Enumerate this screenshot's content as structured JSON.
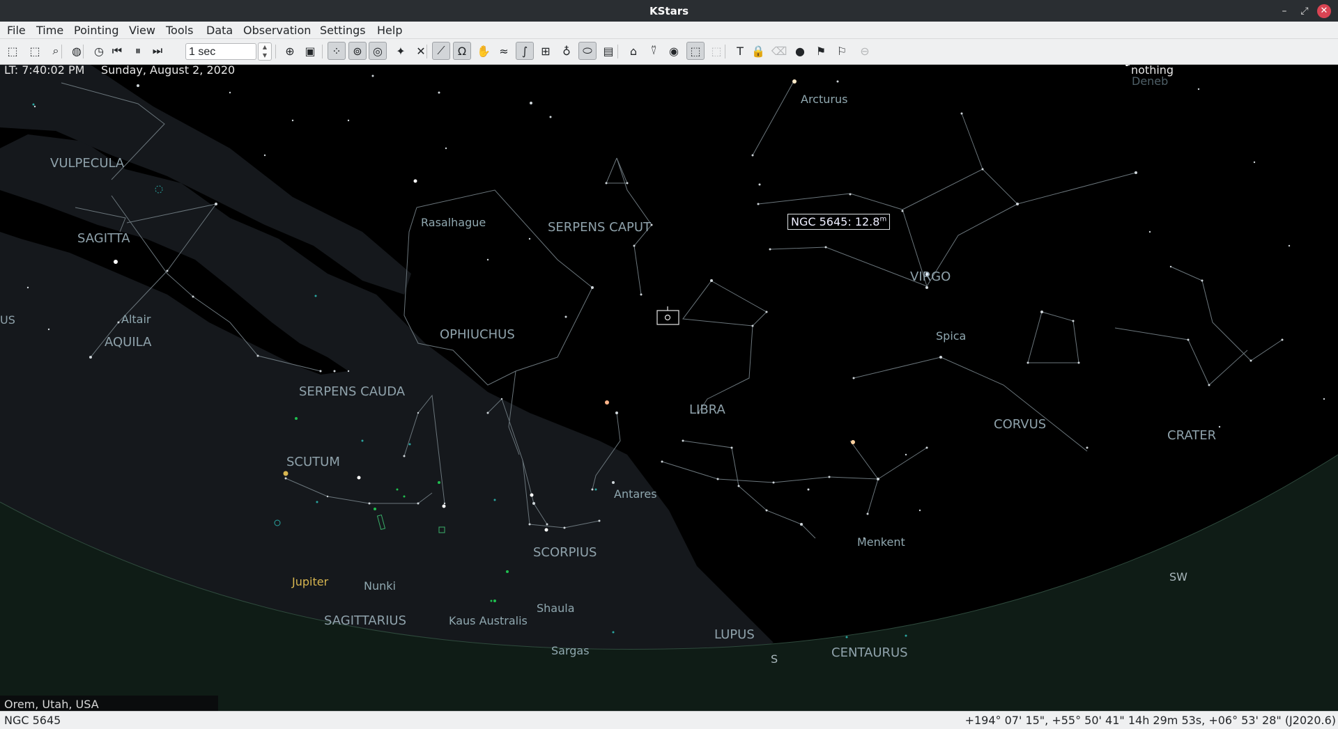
{
  "window": {
    "title": "KStars"
  },
  "menu": [
    "File",
    "Time",
    "Pointing",
    "View",
    "Tools",
    "Data",
    "Observation",
    "Settings",
    "Help"
  ],
  "toolbar": {
    "timestep": "1 sec",
    "buttons": [
      {
        "icon": "zoom-fit-icon",
        "glyph": "⬚",
        "checked": false,
        "disabled": false
      },
      {
        "icon": "zoom-select-icon",
        "glyph": "⬚",
        "checked": false,
        "disabled": false
      },
      {
        "icon": "search-icon",
        "glyph": "⌕",
        "checked": false,
        "disabled": false
      },
      {
        "icon": "globe-icon",
        "glyph": "◍",
        "checked": false,
        "disabled": false
      },
      {
        "icon": "clock-icon",
        "glyph": "◷",
        "checked": false,
        "disabled": false
      },
      {
        "icon": "step-back-icon",
        "glyph": "⏮",
        "checked": false,
        "disabled": false
      },
      {
        "icon": "pause-icon",
        "glyph": "⏸",
        "checked": false,
        "disabled": false
      },
      {
        "icon": "step-forward-icon",
        "glyph": "⏭",
        "checked": false,
        "disabled": false
      },
      {
        "icon": "crosshair-icon",
        "glyph": "⊕",
        "checked": false,
        "disabled": false
      },
      {
        "icon": "image-icon",
        "glyph": "▣",
        "checked": false,
        "disabled": false
      },
      {
        "icon": "stars-icon",
        "glyph": "⁘",
        "checked": true,
        "disabled": false
      },
      {
        "icon": "deep-sky-icon",
        "glyph": "⊚",
        "checked": true,
        "disabled": false
      },
      {
        "icon": "target-icon",
        "glyph": "◎",
        "checked": true,
        "disabled": false
      },
      {
        "icon": "sparkle-icon",
        "glyph": "✦",
        "checked": false,
        "disabled": false
      },
      {
        "icon": "satellite-icon",
        "glyph": "✕",
        "checked": false,
        "disabled": false
      },
      {
        "icon": "constellation-lines-icon",
        "glyph": "⟋",
        "checked": true,
        "disabled": false
      },
      {
        "icon": "constellation-names-icon",
        "glyph": "Ω",
        "checked": true,
        "disabled": false
      },
      {
        "icon": "hand-icon",
        "glyph": "✋",
        "checked": false,
        "disabled": false
      },
      {
        "icon": "milky-way-icon",
        "glyph": "≈",
        "checked": false,
        "disabled": false
      },
      {
        "icon": "ecliptic-icon",
        "glyph": "∫",
        "checked": true,
        "disabled": false
      },
      {
        "icon": "grid-icon",
        "glyph": "⊞",
        "checked": false,
        "disabled": false
      },
      {
        "icon": "planets-icon",
        "glyph": "♁",
        "checked": false,
        "disabled": false
      },
      {
        "icon": "horizon-icon",
        "glyph": "⬭",
        "checked": true,
        "disabled": false
      },
      {
        "icon": "hips-icon",
        "glyph": "▤",
        "checked": false,
        "disabled": false
      },
      {
        "icon": "observatory-icon",
        "glyph": "⌂",
        "checked": false,
        "disabled": false
      },
      {
        "icon": "telescope-icon",
        "glyph": "⍢",
        "checked": false,
        "disabled": false
      },
      {
        "icon": "supernova-icon",
        "glyph": "◉",
        "checked": false,
        "disabled": false
      },
      {
        "icon": "fov-icon",
        "glyph": "⬚",
        "checked": true,
        "disabled": false
      },
      {
        "icon": "fov-disabled-icon",
        "glyph": "⬚",
        "checked": false,
        "disabled": true
      },
      {
        "icon": "text-icon",
        "glyph": "T",
        "checked": false,
        "disabled": false
      },
      {
        "icon": "lock-icon",
        "glyph": "🔒",
        "checked": false,
        "disabled": false
      },
      {
        "icon": "eraser-icon",
        "glyph": "⌫",
        "checked": false,
        "disabled": true
      },
      {
        "icon": "record-icon",
        "glyph": "●",
        "checked": false,
        "disabled": false
      },
      {
        "icon": "flag-icon",
        "glyph": "⚑",
        "checked": false,
        "disabled": false
      },
      {
        "icon": "flag-outline-icon",
        "glyph": "⚐",
        "checked": false,
        "disabled": false
      },
      {
        "icon": "no-entry-icon",
        "glyph": "⊖",
        "checked": false,
        "disabled": true
      }
    ]
  },
  "sky": {
    "time_label": "LT: 7:40:02 PM",
    "date_label": "Sunday, August 2, 2020",
    "focus_label": "nothing",
    "location": "Orem, Utah, USA",
    "tooltip_text": "NGC 5645: 12.8",
    "tooltip_unit": "m",
    "constellations": [
      "VULPECULA",
      "SAGITTA",
      "AQUILA",
      "SERPENS CAPUT",
      "OPHIUCHUS",
      "SERPENS CAUDA",
      "SCUTUM",
      "SCORPIUS",
      "SAGITTARIUS",
      "LUPUS",
      "CENTAURUS",
      "LIBRA",
      "VIRGO",
      "CORVUS",
      "CRATER"
    ],
    "stars": [
      "Arcturus",
      "Deneb",
      "Rasalhague",
      "Altair",
      "Spica",
      "Antares",
      "Menkent",
      "Jupiter",
      "Nunki",
      "Shaula",
      "Kaus Australis",
      "Sargas"
    ],
    "horizon": [
      "SW",
      "S",
      "US"
    ],
    "colors": {
      "ground": "#0f1c16",
      "milky_way": "#15181c",
      "planet": "#d8b650",
      "star_label": "#90a8b0"
    }
  },
  "status": {
    "object": "NGC 5645",
    "coords": "+194° 07' 15\", +55° 50' 41\"  14h 29m 53s, +06° 53' 28\" (J2020.6)"
  }
}
